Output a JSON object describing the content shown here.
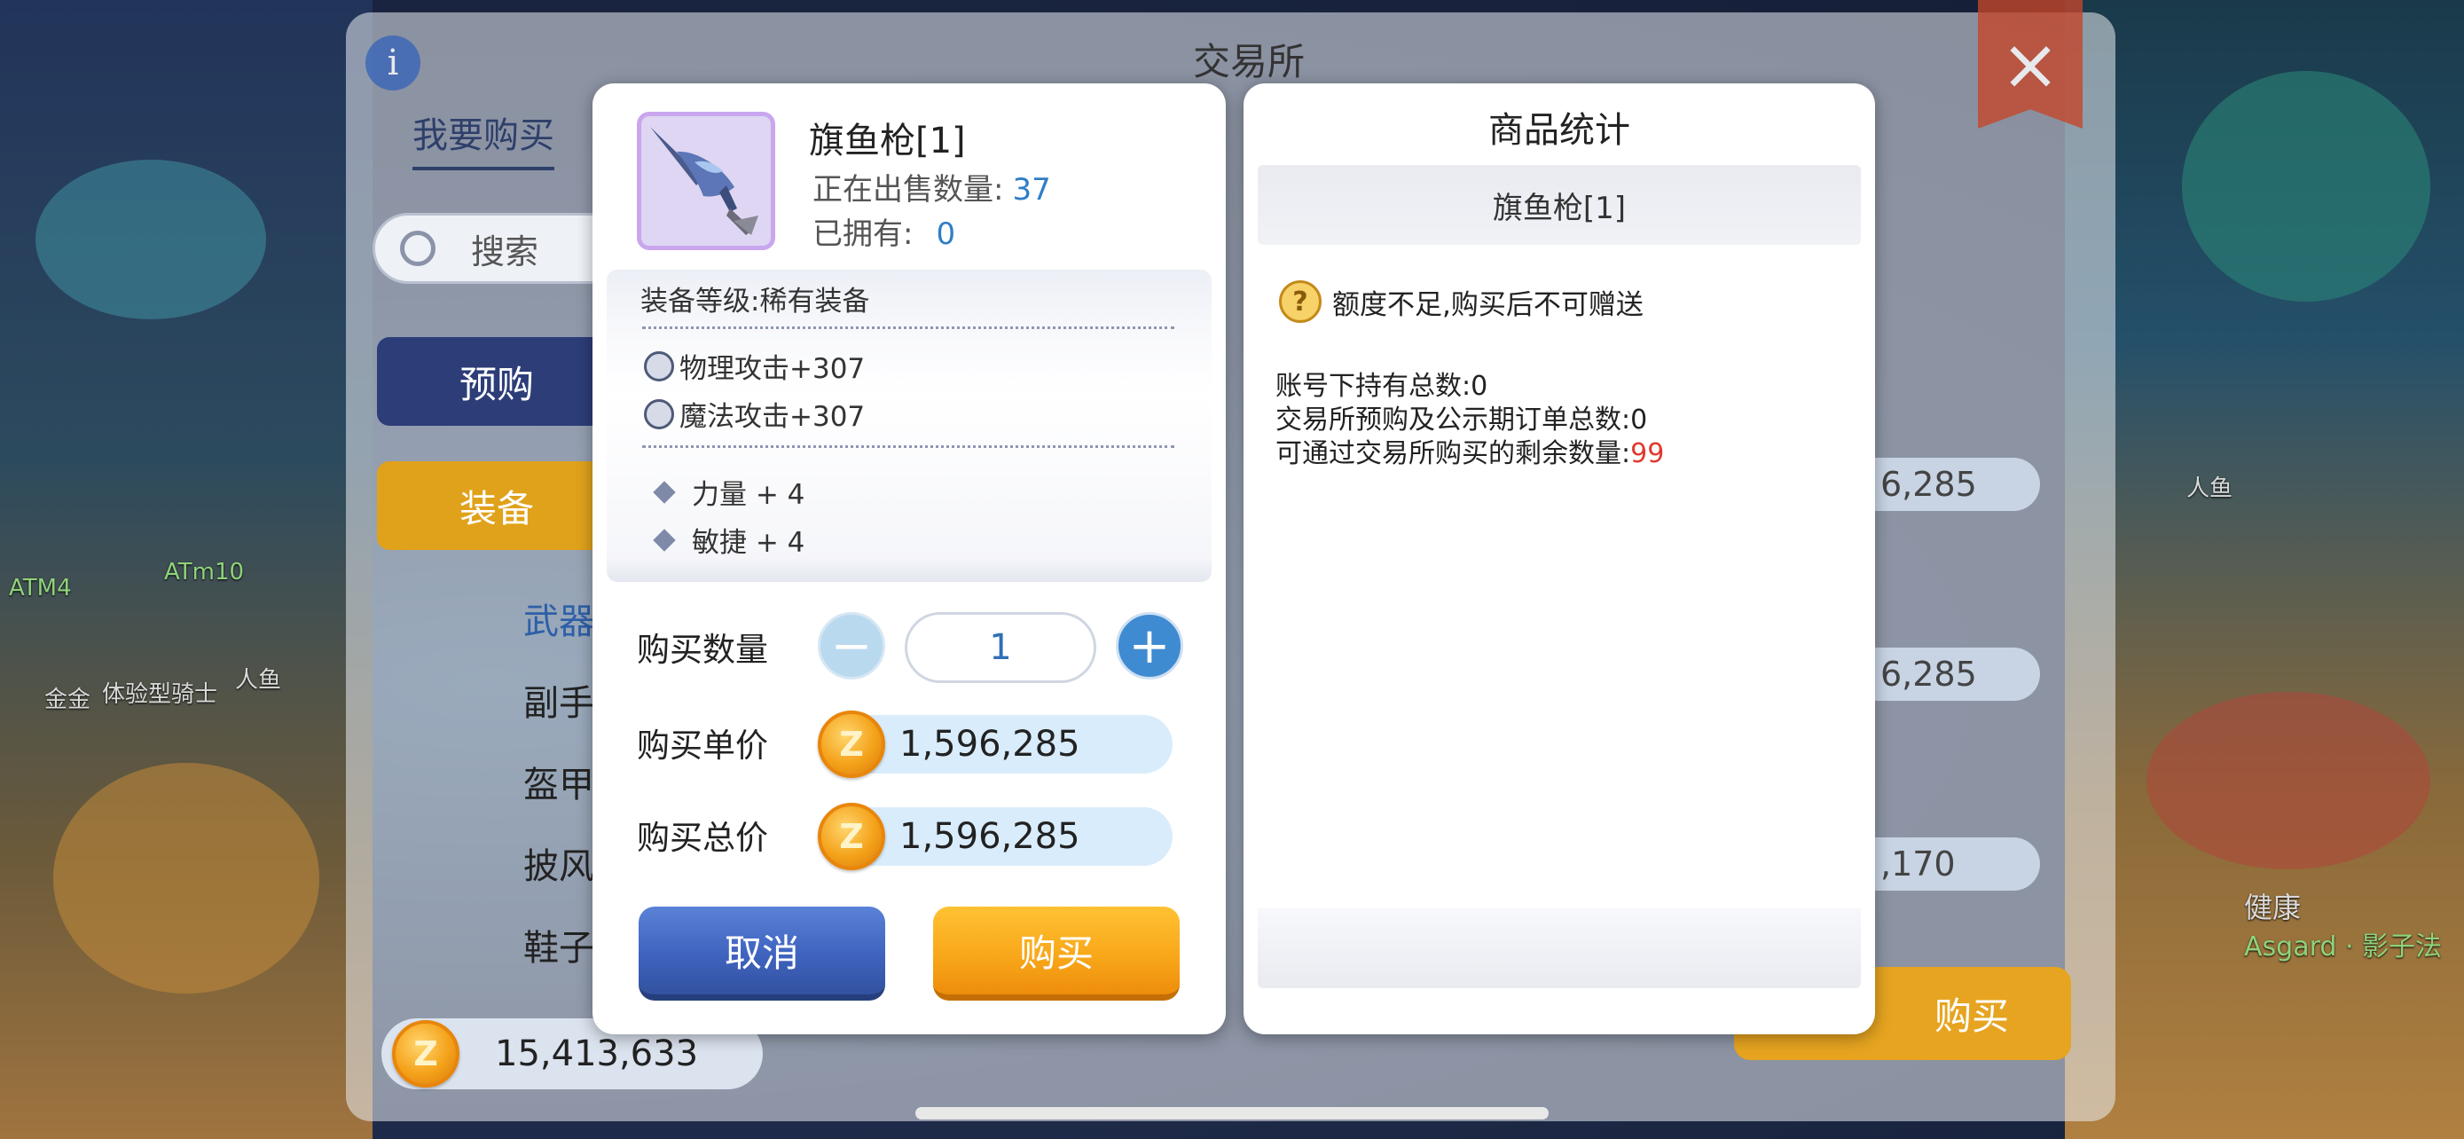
{
  "background": {
    "world_labels": [
      "ATm10",
      "ATM4",
      "金金",
      "体验型骑士",
      "人鱼",
      "人鱼",
      "健康",
      "Asgard · 影子法"
    ]
  },
  "exchange": {
    "title": "交易所",
    "info_icon": "i",
    "close_icon": "×",
    "tab_buy": "我要购买",
    "search_placeholder": "搜索",
    "side_buttons": {
      "preorder": "预购",
      "equipment": "装备"
    },
    "categories": [
      "武器",
      "副手",
      "盔甲",
      "披风",
      "鞋子"
    ],
    "balance": "15,413,633",
    "right_values": [
      "6,285",
      "6,285",
      ",170"
    ],
    "buy_button": "购买"
  },
  "purchase_dialog": {
    "item_name": "旗鱼枪[1]",
    "on_sale_label": "正在出售数量:",
    "on_sale_count": "37",
    "owned_label": "已拥有:",
    "owned_count": "0",
    "grade_label": "装备等级:",
    "grade_value": "稀有装备",
    "attributes": [
      "物理攻击+307",
      "魔法攻击+307"
    ],
    "bonuses": [
      "力量 + 4",
      "敏捷 + 4"
    ],
    "quantity_label": "购买数量",
    "quantity_value": "1",
    "minus_symbol": "−",
    "plus_symbol": "+",
    "unit_price_label": "购买单价",
    "unit_price": "1,596,285",
    "total_price_label": "购买总价",
    "total_price": "1,596,285",
    "coin_letter": "Z",
    "cancel_label": "取消",
    "buy_label": "购买"
  },
  "stats_dialog": {
    "title": "商品统计",
    "item_name": "旗鱼枪[1]",
    "warning": "额度不足,购买后不可赠送",
    "warning_icon": "?",
    "lines": [
      {
        "label": "账号下持有总数:",
        "value": "0"
      },
      {
        "label": "交易所预购及公示期订单总数:",
        "value": "0"
      },
      {
        "label": "可通过交易所购买的剩余数量:",
        "value": "99"
      }
    ]
  },
  "colors": {
    "accent_blue": "#2f7ec7",
    "remaining_red": "#e03a2e",
    "buy_orange": "#f8a81a",
    "cancel_blue": "#3f63bf"
  }
}
